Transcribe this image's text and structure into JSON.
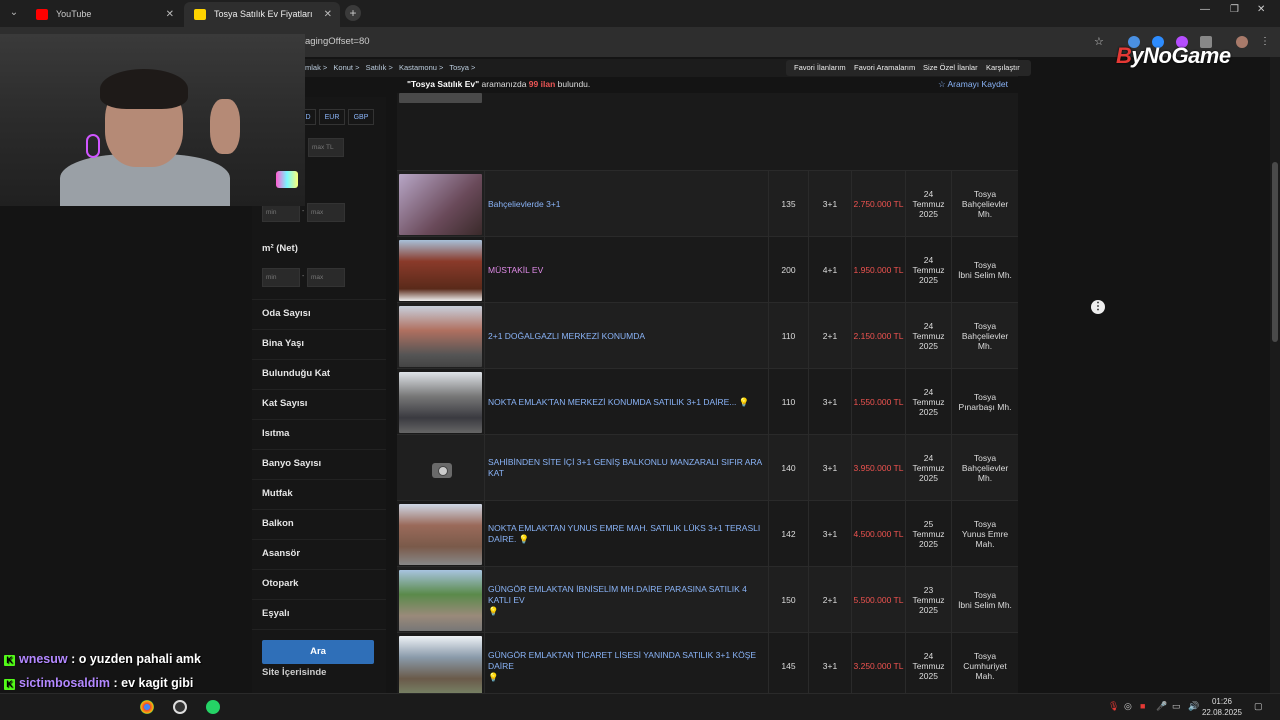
{
  "browser": {
    "tabs": [
      {
        "title": "YouTube",
        "favicon_color": "#ff0000"
      },
      {
        "title": "Tosya Satılık Ev Fiyatları sahibin",
        "favicon_color": "#ffd400"
      }
    ],
    "url": "agingOffset=80"
  },
  "brand": {
    "b": "B",
    "rest": "yNoGame"
  },
  "breadcrumbs": [
    "mlak >",
    "Konut >",
    "Satılık >",
    "Kastamonu >",
    "Tosya >"
  ],
  "toplinks": [
    "Favori İlanlarım",
    "Favori Aramalarım",
    "Size Özel İlanlar",
    "Karşılaştır"
  ],
  "result": {
    "query": "\"Tosya Satılık Ev\"",
    "middle": "aramanızda",
    "count": "99 ilan",
    "suffix": "bulundu.",
    "save_label": "Aramayı Kaydet"
  },
  "sidebar": {
    "currencies": [
      "D",
      "EUR",
      "GBP"
    ],
    "price_max_placeholder": "max TL",
    "min_placeholder": "min",
    "max_placeholder": "max",
    "m2_label": "m² (Net)",
    "filters": [
      "Oda Sayısı",
      "Bina Yaşı",
      "Bulunduğu Kat",
      "Kat Sayısı",
      "Isıtma",
      "Banyo Sayısı",
      "Mutfak",
      "Balkon",
      "Asansör",
      "Otopark",
      "Eşyalı"
    ],
    "search_button": "Ara",
    "site_ici": "Site İçerisinde"
  },
  "listings": [
    {
      "title": "Bahçelievlerde 3+1",
      "m2": "135",
      "rooms": "3+1",
      "price": "2.750.000 TL",
      "date": [
        "24",
        "Temmuz",
        "2025"
      ],
      "loc": [
        "Tosya",
        "Bahçelievler",
        "Mh."
      ],
      "thumb": "#8a6f7a",
      "visited": false,
      "bulb": false
    },
    {
      "title": "MÜSTAKİL EV",
      "m2": "200",
      "rooms": "4+1",
      "price": "1.950.000 TL",
      "date": [
        "24",
        "Temmuz",
        "2025"
      ],
      "loc": [
        "Tosya",
        "İbni Selim Mh."
      ],
      "thumb": "#7a3a2a",
      "visited": true,
      "bulb": false
    },
    {
      "title": "2+1 DOĞALGAZLI MERKEZİ KONUMDA",
      "m2": "110",
      "rooms": "2+1",
      "price": "2.150.000 TL",
      "date": [
        "24",
        "Temmuz",
        "2025"
      ],
      "loc": [
        "Tosya",
        "Bahçelievler",
        "Mh."
      ],
      "thumb": "#6a6a70",
      "visited": false,
      "bulb": false
    },
    {
      "title": "NOKTA EMLAK'TAN MERKEZİ KONUMDA SATILIK 3+1 DAİRE...",
      "m2": "110",
      "rooms": "3+1",
      "price": "1.550.000 TL",
      "date": [
        "24",
        "Temmuz",
        "2025"
      ],
      "loc": [
        "Tosya",
        "Pınarbaşı Mh."
      ],
      "thumb": "#5a5a60",
      "visited": false,
      "bulb": true
    },
    {
      "title": "SAHİBİNDEN SİTE İÇİ 3+1 GENİŞ BALKONLU MANZARALI SIFIR ARA KAT",
      "m2": "140",
      "rooms": "3+1",
      "price": "3.950.000 TL",
      "date": [
        "24",
        "Temmuz",
        "2025"
      ],
      "loc": [
        "Tosya",
        "Bahçelievler",
        "Mh."
      ],
      "thumb": "",
      "visited": false,
      "bulb": false
    },
    {
      "title": "NOKTA EMLAK'TAN YUNUS EMRE MAH. SATILIK LÜKS 3+1 TERASLI DAİRE.",
      "m2": "142",
      "rooms": "3+1",
      "price": "4.500.000 TL",
      "date": [
        "25",
        "Temmuz",
        "2025"
      ],
      "loc": [
        "Tosya",
        "Yunus Emre",
        "Mah."
      ],
      "thumb": "#8a6a5a",
      "visited": false,
      "bulb": true
    },
    {
      "title": "GÜNGÖR EMLAKTAN İBNİSELİM MH.DAİRE PARASINA SATILIK 4 KATLI EV",
      "m2": "150",
      "rooms": "2+1",
      "price": "5.500.000 TL",
      "date": [
        "23",
        "Temmuz",
        "2025"
      ],
      "loc": [
        "Tosya",
        "İbni Selim Mh."
      ],
      "thumb": "#5a7a5a",
      "visited": false,
      "bulb": true
    },
    {
      "title": "GÜNGÖR EMLAKTAN TİCARET LİSESİ YANINDA SATILIK 3+1 KÖŞE DAİRE",
      "m2": "145",
      "rooms": "3+1",
      "price": "3.250.000 TL",
      "date": [
        "24",
        "Temmuz",
        "2025"
      ],
      "loc": [
        "Tosya",
        "Cumhuriyet",
        "Mah."
      ],
      "thumb": "#6a7a8a",
      "visited": false,
      "bulb": true
    }
  ],
  "chat": [
    {
      "user": "wnesuw",
      "msg": ": o yuzden pahali amk"
    },
    {
      "user": "sictimbosaldim",
      "msg": ": ev kagit gibi"
    },
    {
      "user": "sictimbosaldim",
      "msg": ":"
    }
  ],
  "taskbar": {
    "time": "01:26",
    "date": "22.08.2025"
  }
}
